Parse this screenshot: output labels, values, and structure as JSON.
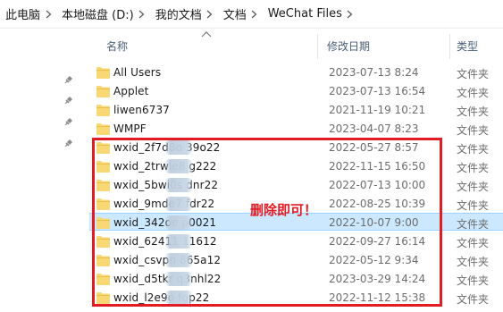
{
  "breadcrumb": [
    "此电脑",
    "本地磁盘 (D:)",
    "我的文档",
    "文档",
    "WeChat Files"
  ],
  "columns": {
    "name": "名称",
    "modified": "修改日期",
    "type": "类型"
  },
  "files": [
    {
      "name": "All Users",
      "date": "2023-07-13 8:24",
      "type": "文件夹"
    },
    {
      "name": "Applet",
      "date": "2023-07-13 16:54",
      "type": "文件夹"
    },
    {
      "name": "liwen6737",
      "date": "2021-11-19 10:21",
      "type": "文件夹"
    },
    {
      "name": "WMPF",
      "date": "2023-04-07 8:23",
      "type": "文件夹"
    },
    {
      "name": "wxid_2f7d8o       39o22",
      "date": "2022-05-27 8:57",
      "type": "文件夹"
    },
    {
      "name": "wxid_2trwle8       g222",
      "date": "2022-11-15 16:50",
      "type": "文件夹"
    },
    {
      "name": "wxid_5bwi0s       dnr22",
      "date": "2022-07-13 10:00",
      "type": "文件夹"
    },
    {
      "name": "wxid_9mde7       fdr22",
      "date": "2022-08-25 10:39",
      "type": "文件夹"
    },
    {
      "name": "wxid_342oe       p0021",
      "date": "2022-10-07 9:00",
      "type": "文件夹"
    },
    {
      "name": "wxid_62411       11612",
      "date": "2022-09-27 16:14",
      "type": "文件夹"
    },
    {
      "name": "wxid_csvpn       865a12",
      "date": "2022-05-12 9:34",
      "type": "文件夹"
    },
    {
      "name": "wxid_d5tkr       q3nhl22",
      "date": "2023-03-29 14:24",
      "type": "文件夹"
    },
    {
      "name": "wxid_l2e9o       fgp22",
      "date": "2022-11-12 15:38",
      "type": "文件夹"
    }
  ],
  "annotation": "删除即可！",
  "colors": {
    "annotation_red": "#e31b23",
    "selection_bg": "#cce8ff",
    "folder_yellow": "#f8d775"
  },
  "icons": {
    "folder": "folder-icon",
    "pin": "pin-icon",
    "separator": "chevron-right-icon"
  }
}
